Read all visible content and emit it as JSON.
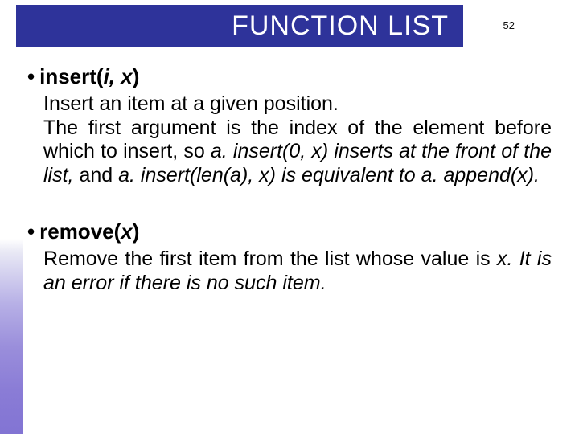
{
  "header": {
    "title": "FUNCTION LIST"
  },
  "page_number": "52",
  "items": [
    {
      "signature_prefix": "insert(",
      "signature_args": "i, x",
      "signature_suffix": ")",
      "line1": "Insert an item at a given position.",
      "line2a": "The first argument is the index of the element before which to insert, so ",
      "code1": "a. insert(0, x) inserts at the front of the list,",
      "mid": " and ",
      "code2": "a. insert(len(a), x) is equivalent to ",
      "code3": "a. append(x)."
    },
    {
      "signature_prefix": "remove(",
      "signature_args": "x",
      "signature_suffix": ")",
      "body_a": "Remove the first item from the list whose value is ",
      "body_b": "x. It is an error if there is no such item."
    }
  ]
}
